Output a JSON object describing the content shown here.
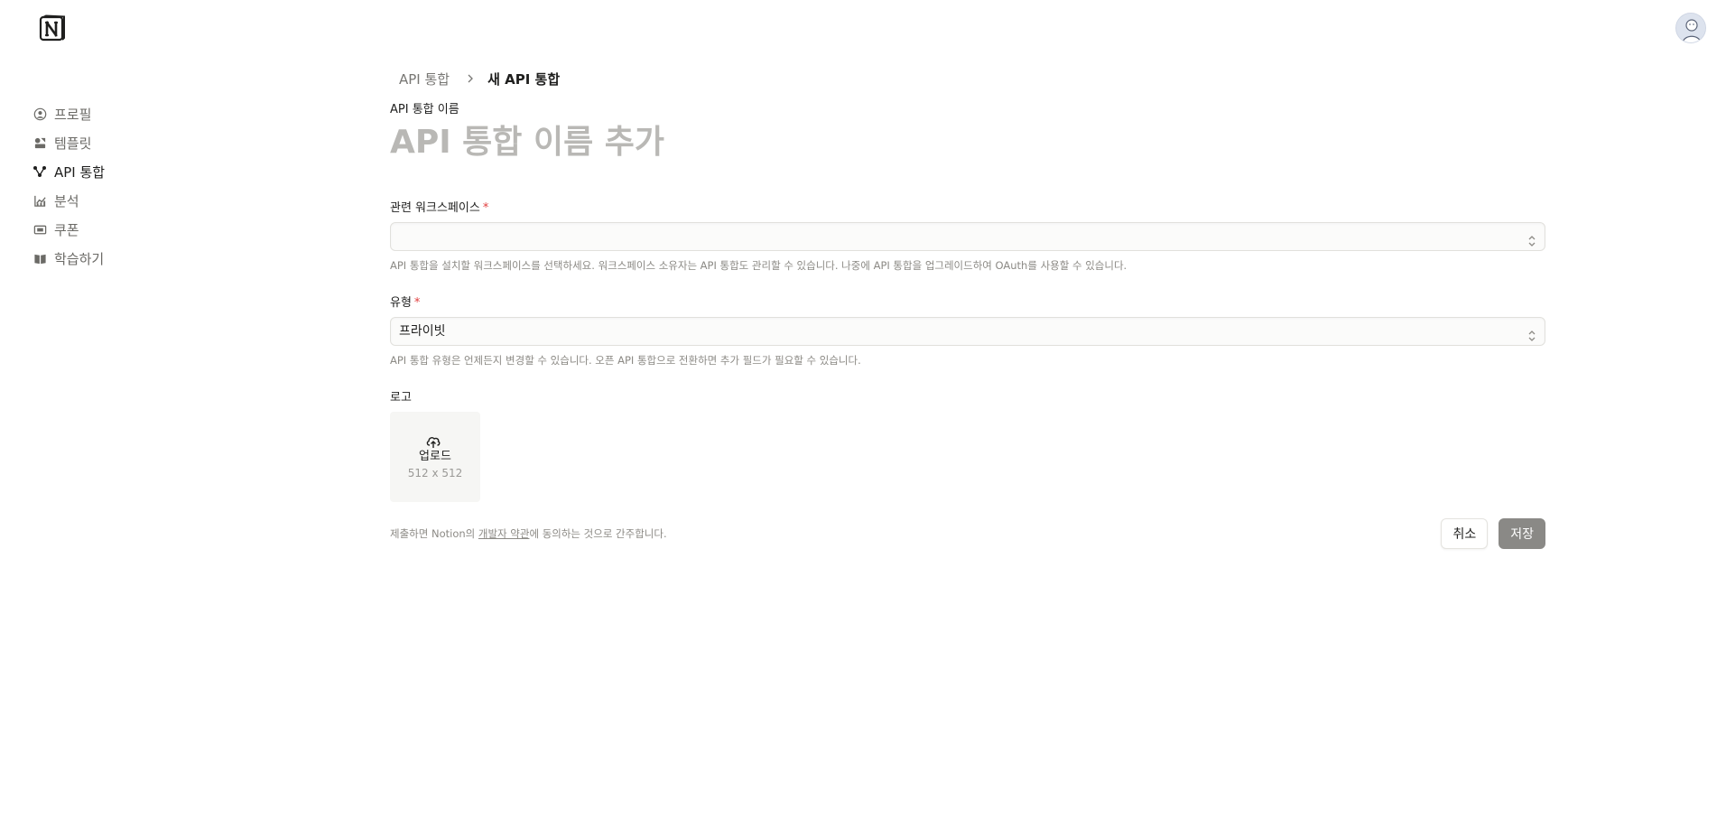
{
  "header": {
    "logo_icon": "notion-logo-icon",
    "avatar_icon": "user-avatar-icon"
  },
  "sidebar": {
    "items": [
      {
        "label": "프로필",
        "icon": "profile-icon",
        "active": false
      },
      {
        "label": "템플릿",
        "icon": "shapes-icon",
        "active": false
      },
      {
        "label": "API 통합",
        "icon": "nodes-icon",
        "active": true
      },
      {
        "label": "분석",
        "icon": "analytics-icon",
        "active": false
      },
      {
        "label": "쿠폰",
        "icon": "ticket-icon",
        "active": false
      },
      {
        "label": "학습하기",
        "icon": "book-icon",
        "active": false
      }
    ]
  },
  "breadcrumb": {
    "parent": "API 통합",
    "current": "새 API 통합"
  },
  "form": {
    "name_label": "API 통합 이름",
    "name_placeholder": "API 통합 이름 추가",
    "name_value": "",
    "required_mark": "*",
    "workspace": {
      "label": "관련 워크스페이스",
      "value": "",
      "hint": "API 통합을 설치할 워크스페이스를 선택하세요. 워크스페이스 소유자는 API 통합도 관리할 수 있습니다. 나중에 API 통합을 업그레이드하여 OAuth를 사용할 수 있습니다."
    },
    "type": {
      "label": "유형",
      "value": "프라이빗",
      "hint": "API 통합 유형은 언제든지 변경할 수 있습니다. 오픈 API 통합으로 전환하면 추가 필드가 필요할 수 있습니다."
    },
    "logo": {
      "label": "로고",
      "upload_text": "업로드",
      "upload_size": "512 x 512"
    }
  },
  "footer": {
    "terms_prefix": "제출하면 Notion의 ",
    "terms_link": "개발자 약관",
    "terms_suffix": "에 동의하는 것으로 간주합니다.",
    "cancel_label": "취소",
    "save_label": "저장"
  },
  "colors": {
    "required": "#e03e3e",
    "save_button": "#8a8986",
    "placeholder": "#b9b8b5"
  }
}
